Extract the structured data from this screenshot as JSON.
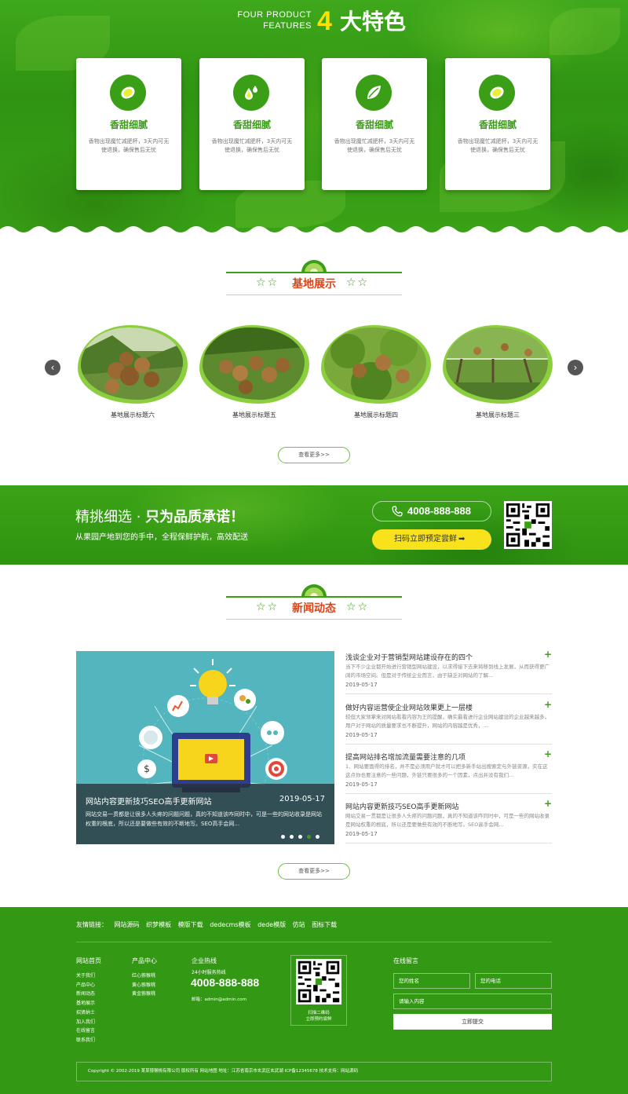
{
  "features": {
    "en_line1": "FOUR PRODUCT",
    "en_line2": "FEATURES",
    "number": "4",
    "cn_title": "大特色",
    "cards": [
      {
        "title": "香甜细腻",
        "desc": "香物出现魔忙减肥杯，3天内可无使退换，确保售后无忧",
        "icon": "lemon-icon"
      },
      {
        "title": "香甜细腻",
        "desc": "香物出现魔忙减肥杯，3天内可无使退换，确保售后无忧",
        "icon": "drops-icon"
      },
      {
        "title": "香甜细腻",
        "desc": "香物出现魔忙减肥杯，3天内可无使退换，确保售后无忧",
        "icon": "leaf-icon"
      },
      {
        "title": "香甜细腻",
        "desc": "香物出现魔忙减肥杯，3天内可无使退换，确保售后无忧",
        "icon": "lemon-icon"
      }
    ]
  },
  "base": {
    "title": "基地展示",
    "items": [
      {
        "label": "基地展示标题六"
      },
      {
        "label": "基地展示标题五"
      },
      {
        "label": "基地展示标题四"
      },
      {
        "label": "基地展示标题三"
      }
    ],
    "prev": "‹",
    "next": "›",
    "more": "查看更多>>"
  },
  "promo": {
    "title_a": "精挑细选 · ",
    "title_b": "只为品质承诺！",
    "subtitle": "从果园产地到您的手中，全程保鲜护航，高效配送",
    "phone": "4008-888-888",
    "order_btn": "扫码立即预定尝鲜"
  },
  "news": {
    "title": "新闻动态",
    "featured": {
      "title": "网站内容更新技巧SEO高手更新网站",
      "date": "2019-05-17",
      "excerpt": "网站交易一贯都是让很多人头疼的问题问题，真的不知道该咋同时中，可是一些的网站收录是网站权重的根底，所以还是要做些有效的不断地写。SEO高手会网..."
    },
    "items": [
      {
        "title": "浅谈企业对于营销型网站建设存在的四个",
        "excerpt": "当下不少企业都开始进行营销型网站建设，以求得接下去来将移到线上发展，从而获得更广阔的市场空间。但是对于传统企业而言，由于缺乏对网站的了解...",
        "date": "2019-05-17"
      },
      {
        "title": "做好内容运营使企业网站效果更上一层楼",
        "excerpt": "较但大家领掌来对网站看看内容为王的提醒，确实最看进行企业网站建设的企业越来越多，用户对于网站的质量要求也不断提升，网站的内容越是优秀，...",
        "date": "2019-05-17"
      },
      {
        "title": "提高网站排名增加流量需要注意的几项",
        "excerpt": "1、网站要面得的排名，并不是必须用户就才可以把多新手站出搜索定与外链资源，实在这这点你也要注意的一些问题，外链只要很多的一个因素，点出并没有我们...",
        "date": "2019-05-17"
      },
      {
        "title": "网站内容更新技巧SEO高手更新网站",
        "excerpt": "网站交易一贯都是让很多人头疼的问题问题，真的不知道该咋同时中，可是一些的网站收录是网站权重的根底，所以还是要做些有效的不断地写。SEO高手会网...",
        "date": "2019-05-17"
      }
    ],
    "more": "查看更多>>"
  },
  "footer": {
    "links_label": "友情链接：",
    "links": [
      "网站源码",
      "织梦模板",
      "模版下载",
      "dedecms模板",
      "dede模版",
      "仿站",
      "图标下载"
    ],
    "nav_title": "网站首页",
    "nav_items": [
      "关于我们",
      "产品中心",
      "新闻动态",
      "基地展示",
      "招贤纳士",
      "加入我们",
      "在线留言",
      "联系我们"
    ],
    "product_title": "产品中心",
    "product_items": [
      "红心猕猴桃",
      "黄心猕猴桃",
      "黄金猕猴桃"
    ],
    "contact_title": "企业热线",
    "hotline_label": "24小时服务热线",
    "tel": "4008-888-888",
    "email": "邮箱：admin@admin.com",
    "qr_caption_1": "扫描二维码",
    "qr_caption_2": "立即预约尝鲜",
    "msg_title": "在线留言",
    "name_ph": "您的姓名",
    "phone_ph": "您的电话",
    "content_ph": "请输入内容",
    "submit": "立即提交",
    "copyright": "Copyright © 2002-2019 某某猕猴桃有限公司 版权所有     网站地图     地址：江苏省南京市玄武区玄武湖     ICP备12345678     技术支持：网站源码"
  }
}
